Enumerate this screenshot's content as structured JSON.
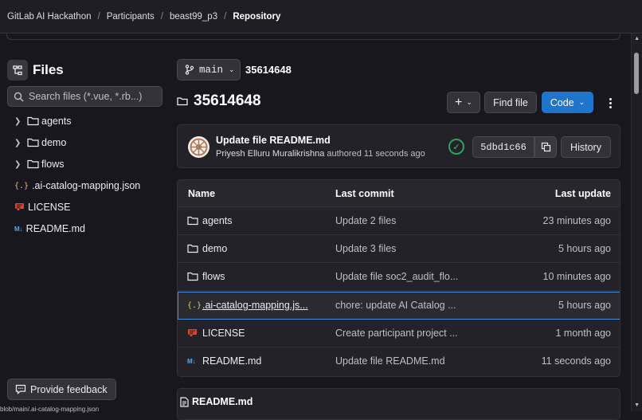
{
  "breadcrumb": [
    "GitLab AI Hackathon",
    "Participants",
    "beast99_p3",
    "Repository"
  ],
  "sidebar": {
    "title": "Files",
    "search_placeholder": "Search files (*.vue, *.rb...)",
    "tree": [
      {
        "label": "agents",
        "type": "folder"
      },
      {
        "label": "demo",
        "type": "folder"
      },
      {
        "label": "flows",
        "type": "folder"
      },
      {
        "label": ".ai-catalog-mapping.json",
        "type": "json"
      },
      {
        "label": "LICENSE",
        "type": "license"
      },
      {
        "label": "README.md",
        "type": "markdown"
      }
    ],
    "feedback_label": "Provide feedback"
  },
  "status_url": "blob/main/.ai-catalog-mapping.json",
  "header": {
    "branch": "main",
    "path": "35614648",
    "title": "35614648",
    "find_file": "Find file",
    "code": "Code"
  },
  "commit": {
    "message": "Update file README.md",
    "author": "Priyesh Elluru Muralikrishna",
    "action": "authored",
    "time": "11 seconds ago",
    "sha": "5dbd1c66",
    "history": "History"
  },
  "table": {
    "headers": {
      "name": "Name",
      "last_commit": "Last commit",
      "last_update": "Last update"
    },
    "rows": [
      {
        "name": "agents",
        "type": "folder",
        "commit": "Update 2 files",
        "date": "23 minutes ago"
      },
      {
        "name": "demo",
        "type": "folder",
        "commit": "Update 3 files",
        "date": "5 hours ago"
      },
      {
        "name": "flows",
        "type": "folder",
        "commit": "Update file soc2_audit_flo...",
        "date": "10 minutes ago"
      },
      {
        "name": ".ai-catalog-mapping.js...",
        "type": "json",
        "commit": "chore: update AI Catalog ...",
        "date": "5 hours ago"
      },
      {
        "name": "LICENSE",
        "type": "license",
        "commit": "Create participant project ...",
        "date": "1 month ago"
      },
      {
        "name": "README.md",
        "type": "markdown",
        "commit": "Update file README.md",
        "date": "11 seconds ago"
      }
    ]
  },
  "readme": {
    "title": "README.md"
  },
  "colors": {
    "accent": "#1f75cb",
    "success": "#2da160",
    "focus": "#428fdc"
  }
}
